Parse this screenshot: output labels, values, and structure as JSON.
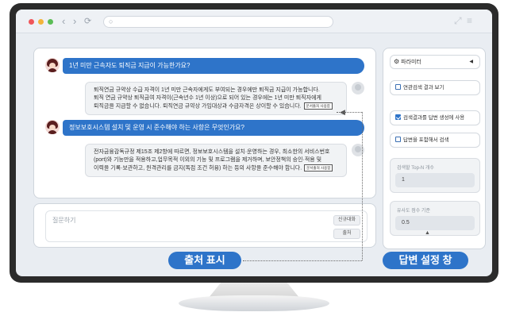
{
  "browser": {
    "nav_back": "‹",
    "nav_forward": "›",
    "nav_reload": "⟳",
    "url_icon": "○",
    "expand_icon": "⤢",
    "menu_icon": "≡"
  },
  "chat": {
    "messages": [
      {
        "question": "1년 미만 근속자도 퇴직금 지급이 가능한가요?",
        "answer_lines": [
          "퇴직연금 규약상 수급 자격이 1년 미만 근속자에게도 부여되는 경우에만 퇴직금 지급이 가능합니다.",
          "퇴직 연금 규약상 퇴직금여 자격이(근속년수 1년 이상)으로 되어 있는 경우에는 1년 미만 퇴직자에게",
          "퇴직금을 지급할 수 없습니다. 퇴직연금 규약상 가입대상과 수급자격은 상이할 수 있습니다."
        ],
        "source_label": "문서출처 사용함"
      },
      {
        "question": "정보보호시스템 설치 및 운영 시 준수해야 하는 사항은 무엇인가요?",
        "answer_lines": [
          "전자금융감독규정 제15조 제2항에 따르면, 정보보호시스템을 설치·운영하는 경우, 최소한의 서비스번호",
          "(port)와 기능만을 적용하고,업무목적 이외의 기능 및 프로그램을 제거하며, 보안정책의 승인·적용 및",
          "이력을 기록·보관하고, 원격관리를 금지(독점 조건 허용) 하는 등의 사항을 준수해야 합니다."
        ],
        "source_label": "문서출처 사용함"
      }
    ]
  },
  "input": {
    "placeholder": "질문하기",
    "new_chat_label": "신규대화",
    "submit_label": "출처"
  },
  "settings": {
    "param_label": "파라미터",
    "options": [
      {
        "label": "연관검색 결과 보기",
        "checked": false
      },
      {
        "label": "검색결과를 답변 생성에 사용",
        "checked": true
      },
      {
        "label": "답변을 포함해서 검색",
        "checked": false
      }
    ],
    "topn_label": "검색할 Top-N 개수",
    "topn_value": "1",
    "similarity_label": "유사도 점수 기준",
    "similarity_value": "0.5"
  },
  "callouts": {
    "source": "출처 표시",
    "settings": "답변 설정 창"
  },
  "colors": {
    "accent": "#2e74c9",
    "frame": "#2b2b2b"
  }
}
